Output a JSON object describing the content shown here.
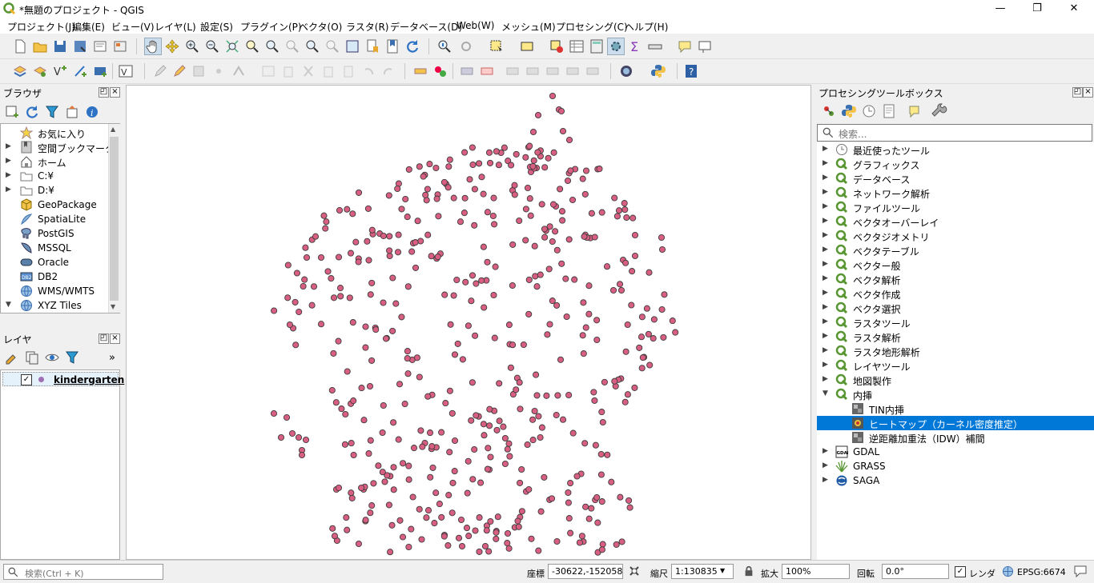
{
  "window": {
    "title": "*無題のプロジェクト - QGIS",
    "minimize": "—",
    "maximize": "❐",
    "close": "✕"
  },
  "menu": [
    "プロジェクト(J)",
    "編集(E)",
    "ビュー(V)",
    "レイヤ(L)",
    "設定(S)",
    "プラグイン(P)",
    "ベクタ(O)",
    "ラスタ(R)",
    "データベース(D)",
    "Web(W)",
    "メッシュ(M)",
    "プロセシング(C)",
    "ヘルプ(H)"
  ],
  "browser": {
    "title": "ブラウザ",
    "items": [
      "お気に入り",
      "空間ブックマーク",
      "ホーム",
      "C:¥",
      "D:¥",
      "GeoPackage",
      "SpatiaLite",
      "PostGIS",
      "MSSQL",
      "Oracle",
      "DB2",
      "WMS/WMTS",
      "XYZ Tiles"
    ],
    "db2_badge": "DB2"
  },
  "layers": {
    "title": "レイヤ",
    "items": [
      {
        "name": "kindergarten",
        "checked": true,
        "check_mark": "✓",
        "symbol_color": "#d94f7a"
      }
    ],
    "more": "»"
  },
  "map": {
    "point_fill": "#d95f82",
    "point_stroke": "#3c3c3c"
  },
  "toolbox": {
    "title": "プロセシングツールボックス",
    "search_placeholder": "検索...",
    "items": [
      {
        "label": "最近使ったツール",
        "icon": "clock-icon",
        "arrow": "▶"
      },
      {
        "label": "グラフィックス",
        "icon": "qgis-icon",
        "arrow": "▶"
      },
      {
        "label": "データベース",
        "icon": "qgis-icon",
        "arrow": "▶"
      },
      {
        "label": "ネットワーク解析",
        "icon": "qgis-icon",
        "arrow": "▶"
      },
      {
        "label": "ファイルツール",
        "icon": "qgis-icon",
        "arrow": "▶"
      },
      {
        "label": "ベクタオーバーレイ",
        "icon": "qgis-icon",
        "arrow": "▶"
      },
      {
        "label": "ベクタジオメトリ",
        "icon": "qgis-icon",
        "arrow": "▶"
      },
      {
        "label": "ベクタテーブル",
        "icon": "qgis-icon",
        "arrow": "▶"
      },
      {
        "label": "ベクター般",
        "icon": "qgis-icon",
        "arrow": "▶"
      },
      {
        "label": "ベクタ解析",
        "icon": "qgis-icon",
        "arrow": "▶"
      },
      {
        "label": "ベクタ作成",
        "icon": "qgis-icon",
        "arrow": "▶"
      },
      {
        "label": "ベクタ選択",
        "icon": "qgis-icon",
        "arrow": "▶"
      },
      {
        "label": "ラスタツール",
        "icon": "qgis-icon",
        "arrow": "▶"
      },
      {
        "label": "ラスタ解析",
        "icon": "qgis-icon",
        "arrow": "▶"
      },
      {
        "label": "ラスタ地形解析",
        "icon": "qgis-icon",
        "arrow": "▶"
      },
      {
        "label": "レイヤツール",
        "icon": "qgis-icon",
        "arrow": "▶"
      },
      {
        "label": "地図製作",
        "icon": "qgis-icon",
        "arrow": "▶"
      },
      {
        "label": "内挿",
        "icon": "qgis-icon",
        "arrow": "▼"
      },
      {
        "label": "TIN内挿",
        "icon": "algorithm-icon",
        "child": true
      },
      {
        "label": "ヒートマップ（カーネル密度推定）",
        "icon": "heatmap-icon",
        "child": true,
        "selected": true
      },
      {
        "label": "逆距離加重法（IDW）補間",
        "icon": "algorithm-icon",
        "child": true
      },
      {
        "label": "GDAL",
        "icon": "gdal-icon",
        "arrow": "▶"
      },
      {
        "label": "GRASS",
        "icon": "grass-icon",
        "arrow": "▶"
      },
      {
        "label": "SAGA",
        "icon": "saga-icon",
        "arrow": "▶"
      }
    ]
  },
  "status": {
    "search_placeholder": "検索(Ctrl + K)",
    "coord_label": "座標",
    "coord_value": "-30622,-152058",
    "scale_label": "縮尺",
    "scale_value": "1:130835",
    "magnifier_label": "拡大",
    "magnifier_value": "100%",
    "rotation_label": "回転",
    "rotation_value": "0.0°",
    "render_label": "レンダ",
    "render_check_mark": "✓",
    "crs": "EPSG:6674"
  },
  "colors": {
    "selection": "#0078d7",
    "qgis_green": "#589632"
  }
}
